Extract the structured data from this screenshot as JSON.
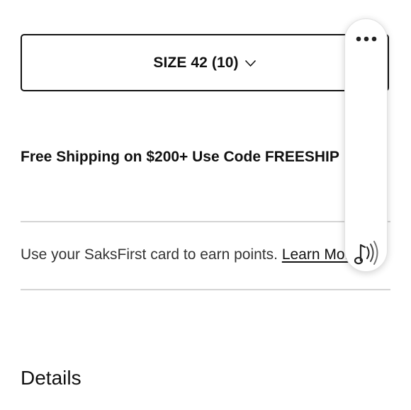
{
  "size_selector": {
    "label": "SIZE 42 (10)",
    "icon": "chevron-down-icon"
  },
  "shipping": {
    "text": "Free Shipping on $200+ Use Code FREESHIP"
  },
  "saksfirst": {
    "text": "Use your SaksFirst card to earn points. ",
    "link_label": "Learn More"
  },
  "details": {
    "heading": "Details"
  },
  "floating_widget": {
    "more_icon": "more-horizontal-icon",
    "audio_icon": "audio-playback-icon"
  }
}
